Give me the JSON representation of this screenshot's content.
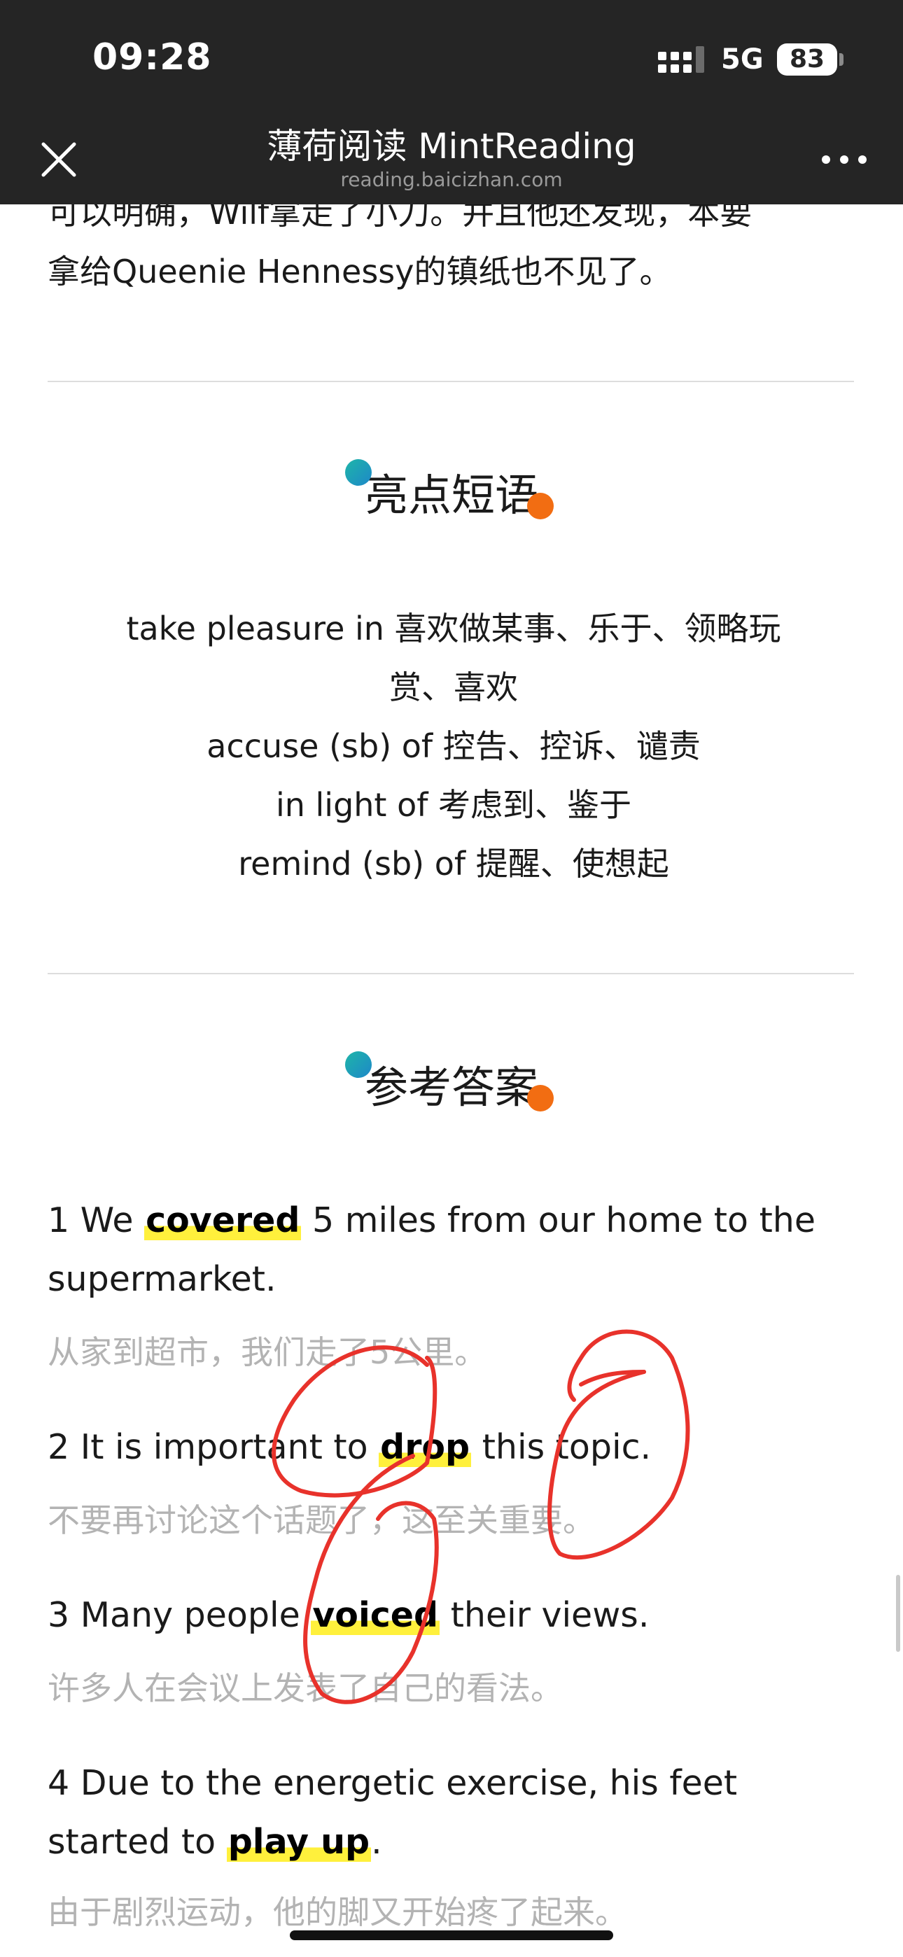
{
  "status_bar": {
    "time": "09:28",
    "network": "5G",
    "battery": "83"
  },
  "nav": {
    "title": "薄荷阅读 MintReading",
    "subtitle": "reading.baicizhan.com",
    "close_icon": "close-icon",
    "more_icon": "more-icon"
  },
  "intro": {
    "line1": "可以明确，Wilf拿走了小刀。并且他还发现，本要",
    "line2": "拿给Queenie Hennessy的镇纸也不见了。"
  },
  "phrases_section": {
    "heading": "亮点短语",
    "items": [
      {
        "line1": "take pleasure in 喜欢做某事、乐于、领略玩",
        "line2": "赏、喜欢"
      },
      {
        "line1": "accuse (sb) of 控告、控诉、谴责"
      },
      {
        "line1": "in light of 考虑到、鉴于"
      },
      {
        "line1": "remind (sb) of 提醒、使想起"
      }
    ]
  },
  "answers_section": {
    "heading": "参考答案",
    "items": [
      {
        "before": "1 We ",
        "keyword": "covered",
        "after": " 5 miles from our home to the supermarket.",
        "translation": "从家到超市，我们走了5公里。"
      },
      {
        "before": "2 It is important to ",
        "keyword": "drop",
        "after": " this topic.",
        "translation": "不要再讨论这个话题了，这至关重要。"
      },
      {
        "before": "3 Many people ",
        "keyword": "voiced",
        "after": " their views.",
        "translation": "许多人在会议上发表了自己的看法。"
      },
      {
        "before": "4 Due to the energetic exercise, his feet started to ",
        "keyword": "play up",
        "after": ".",
        "translation": "由于剧烈运动，他的脚又开始疼了起来。"
      }
    ]
  },
  "colors": {
    "topbar": "#252525",
    "highlight": "#fff03c",
    "accent_teal": "#1fb5a8",
    "accent_orange": "#f26d12",
    "annotation_red": "#e8322b"
  }
}
